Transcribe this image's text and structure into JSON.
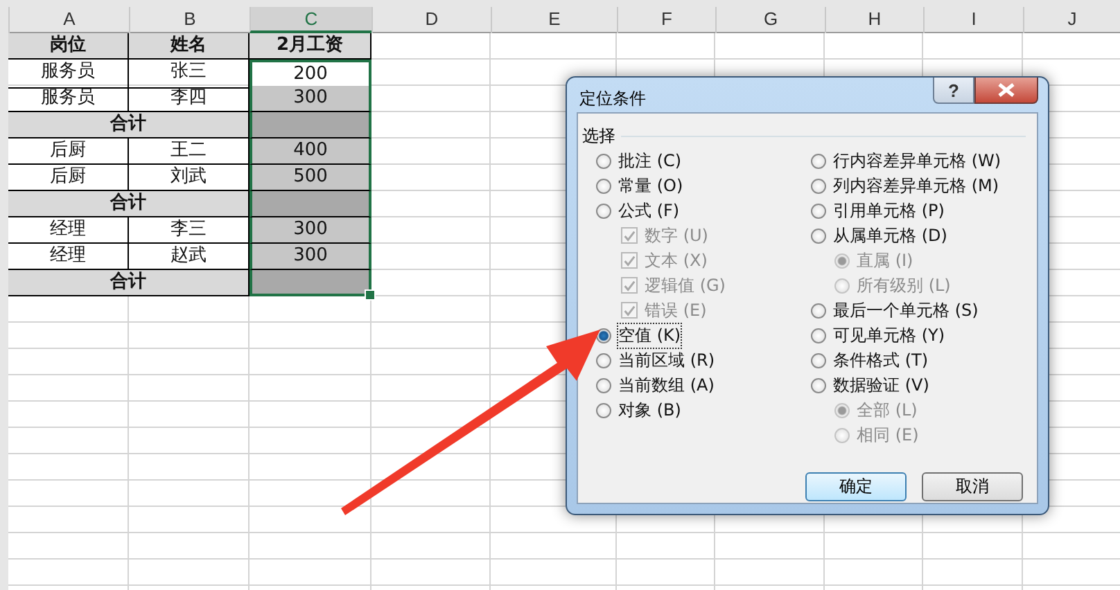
{
  "columns": [
    {
      "label": "A",
      "selected": false
    },
    {
      "label": "B",
      "selected": false
    },
    {
      "label": "C",
      "selected": true
    },
    {
      "label": "D",
      "selected": false
    },
    {
      "label": "E",
      "selected": false
    },
    {
      "label": "F",
      "selected": false
    },
    {
      "label": "G",
      "selected": false
    },
    {
      "label": "H",
      "selected": false
    },
    {
      "label": "I",
      "selected": false
    },
    {
      "label": "J",
      "selected": false
    }
  ],
  "rows": [
    {
      "kind": "header",
      "cells": [
        "岗位",
        "姓名",
        "2月工资"
      ]
    },
    {
      "kind": "data",
      "cells": [
        "服务员",
        "张三",
        "200"
      ],
      "highlighted": false
    },
    {
      "kind": "data",
      "cells": [
        "服务员",
        "李四",
        "300"
      ],
      "highlighted": true
    },
    {
      "kind": "total",
      "cells": [
        "合计"
      ],
      "highlighted": true
    },
    {
      "kind": "data",
      "cells": [
        "后厨",
        "王二",
        "400"
      ],
      "highlighted": true
    },
    {
      "kind": "data",
      "cells": [
        "后厨",
        "刘武",
        "500"
      ],
      "highlighted": true
    },
    {
      "kind": "total",
      "cells": [
        "合计"
      ],
      "highlighted": true
    },
    {
      "kind": "data",
      "cells": [
        "经理",
        "李三",
        "300"
      ],
      "highlighted": true
    },
    {
      "kind": "data",
      "cells": [
        "经理",
        "赵武",
        "300"
      ],
      "highlighted": true
    },
    {
      "kind": "total",
      "cells": [
        "合计"
      ],
      "highlighted": true
    }
  ],
  "dialog": {
    "title": "定位条件",
    "help": "?",
    "group": "选择",
    "left": [
      {
        "kind": "radio",
        "label": "批注 (C)",
        "selected": false,
        "disabled": false
      },
      {
        "kind": "radio",
        "label": "常量 (O)",
        "selected": false,
        "disabled": false
      },
      {
        "kind": "radio",
        "label": "公式 (F)",
        "selected": false,
        "disabled": false
      },
      {
        "kind": "check",
        "label": "数字 (U)",
        "checked": true,
        "disabled": true
      },
      {
        "kind": "check",
        "label": "文本 (X)",
        "checked": true,
        "disabled": true
      },
      {
        "kind": "check",
        "label": "逻辑值 (G)",
        "checked": true,
        "disabled": true
      },
      {
        "kind": "check",
        "label": "错误 (E)",
        "checked": true,
        "disabled": true
      },
      {
        "kind": "radio",
        "label": "空值 (K)",
        "selected": true,
        "disabled": false
      },
      {
        "kind": "radio",
        "label": "当前区域 (R)",
        "selected": false,
        "disabled": false
      },
      {
        "kind": "radio",
        "label": "当前数组 (A)",
        "selected": false,
        "disabled": false
      },
      {
        "kind": "radio",
        "label": "对象 (B)",
        "selected": false,
        "disabled": false
      }
    ],
    "right": [
      {
        "kind": "radio",
        "label": "行内容差异单元格 (W)",
        "selected": false,
        "disabled": false
      },
      {
        "kind": "radio",
        "label": "列内容差异单元格 (M)",
        "selected": false,
        "disabled": false
      },
      {
        "kind": "radio",
        "label": "引用单元格 (P)",
        "selected": false,
        "disabled": false
      },
      {
        "kind": "radio",
        "label": "从属单元格 (D)",
        "selected": false,
        "disabled": false
      },
      {
        "kind": "subradio",
        "label": "直属 (I)",
        "selected": true,
        "disabled": true
      },
      {
        "kind": "subradio",
        "label": "所有级别 (L)",
        "selected": false,
        "disabled": true
      },
      {
        "kind": "radio",
        "label": "最后一个单元格 (S)",
        "selected": false,
        "disabled": false
      },
      {
        "kind": "radio",
        "label": "可见单元格 (Y)",
        "selected": false,
        "disabled": false
      },
      {
        "kind": "radio",
        "label": "条件格式 (T)",
        "selected": false,
        "disabled": false
      },
      {
        "kind": "radio",
        "label": "数据验证 (V)",
        "selected": false,
        "disabled": false
      },
      {
        "kind": "subradio",
        "label": "全部 (L)",
        "selected": true,
        "disabled": true
      },
      {
        "kind": "subradio",
        "label": "相同 (E)",
        "selected": false,
        "disabled": true
      }
    ],
    "buttons": [
      "确定",
      "取消"
    ]
  }
}
